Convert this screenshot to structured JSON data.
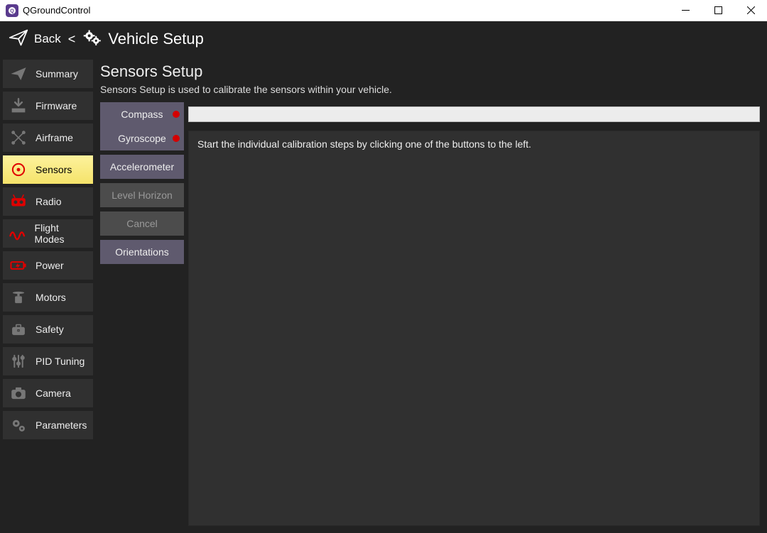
{
  "titlebar": {
    "title": "QGroundControl"
  },
  "header": {
    "back": "Back",
    "lt": "<",
    "title": "Vehicle Setup"
  },
  "sidebar": {
    "items": [
      {
        "label": "Summary",
        "icon": "paperplane",
        "color": "#777",
        "active": false
      },
      {
        "label": "Firmware",
        "icon": "download",
        "color": "#777",
        "active": false
      },
      {
        "label": "Airframe",
        "icon": "quad",
        "color": "#777",
        "active": false
      },
      {
        "label": "Sensors",
        "icon": "target",
        "color": "#e00000",
        "active": true
      },
      {
        "label": "Radio",
        "icon": "rc",
        "color": "#e00000",
        "active": false
      },
      {
        "label": "Flight Modes",
        "icon": "wave",
        "color": "#e00000",
        "active": false
      },
      {
        "label": "Power",
        "icon": "battery",
        "color": "#e00000",
        "active": false
      },
      {
        "label": "Motors",
        "icon": "motor",
        "color": "#777",
        "active": false
      },
      {
        "label": "Safety",
        "icon": "briefcase",
        "color": "#777",
        "active": false
      },
      {
        "label": "PID Tuning",
        "icon": "sliders",
        "color": "#777",
        "active": false
      },
      {
        "label": "Camera",
        "icon": "camera",
        "color": "#777",
        "active": false
      },
      {
        "label": "Parameters",
        "icon": "gears",
        "color": "#777",
        "active": false
      }
    ]
  },
  "content": {
    "title": "Sensors Setup",
    "description": "Sensors Setup is used to calibrate the sensors within your vehicle.",
    "instruction": "Start the individual calibration steps by clicking one of the buttons to the left.",
    "buttons": [
      {
        "label": "Compass",
        "status": "red",
        "disabled": false
      },
      {
        "label": "Gyroscope",
        "status": "red",
        "disabled": false
      },
      {
        "label": "Accelerometer",
        "status": "none",
        "disabled": false
      },
      {
        "label": "Level Horizon",
        "status": "none",
        "disabled": true
      },
      {
        "label": "Cancel",
        "status": "none",
        "disabled": true
      },
      {
        "label": "Orientations",
        "status": "none",
        "disabled": false
      }
    ]
  }
}
